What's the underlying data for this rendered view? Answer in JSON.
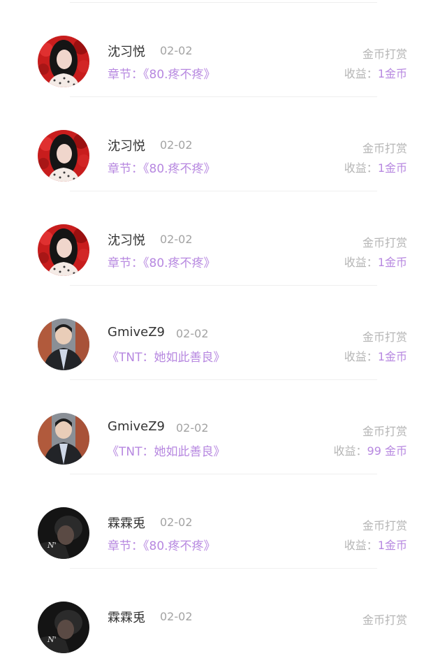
{
  "items": [
    {
      "avatar": "woman-red-roses-avatar",
      "name": "沈习悦",
      "date": "02-02",
      "work": "章节：《80.疼不疼》",
      "type": "金币打赏",
      "income_label": "收益：",
      "income_value": "1金币"
    },
    {
      "avatar": "woman-red-roses-avatar",
      "name": "沈习悦",
      "date": "02-02",
      "work": "章节：《80.疼不疼》",
      "type": "金币打赏",
      "income_label": "收益：",
      "income_value": "1金币"
    },
    {
      "avatar": "woman-red-roses-avatar",
      "name": "沈习悦",
      "date": "02-02",
      "work": "章节：《80.疼不疼》",
      "type": "金币打赏",
      "income_label": "收益：",
      "income_value": "1金币"
    },
    {
      "avatar": "man-jacket-avatar",
      "name": "GmiveZ9",
      "date": "02-02",
      "work": "《TNT：她如此善良》",
      "type": "金币打赏",
      "income_label": "收益：",
      "income_value": "1金币"
    },
    {
      "avatar": "man-jacket-avatar",
      "name": "GmiveZ9",
      "date": "02-02",
      "work": "《TNT：她如此善良》",
      "type": "金币打赏",
      "income_label": "收益：",
      "income_value": "99 金币"
    },
    {
      "avatar": "dark-portrait-avatar",
      "name": "霖霖兎",
      "date": "02-02",
      "work": "章节：《80.疼不疼》",
      "type": "金币打赏",
      "income_label": "收益：",
      "income_value": "1金币"
    },
    {
      "avatar": "dark-portrait-avatar",
      "name": "霖霖兎",
      "date": "02-02",
      "work": "",
      "type": "金币打赏",
      "income_label": "",
      "income_value": ""
    }
  ]
}
